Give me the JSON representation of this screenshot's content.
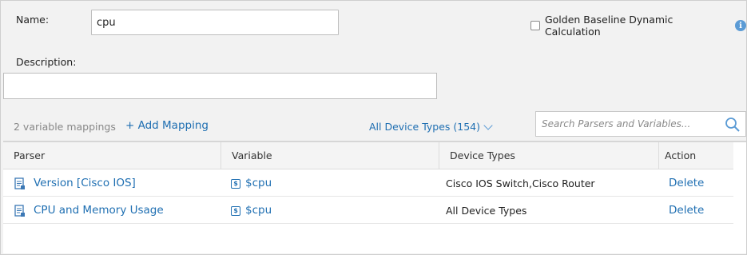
{
  "form": {
    "name_label": "Name:",
    "name_value": "cpu",
    "description_label": "Description:",
    "description_value": "",
    "golden_baseline_label": "Golden Baseline Dynamic Calculation",
    "golden_baseline_checked": false
  },
  "toolbar": {
    "mappings_count": "2 variable mappings",
    "add_mapping_label": "+ Add Mapping",
    "device_filter_label": "All Device Types (154)",
    "search_placeholder": "Search Parsers and Variables..."
  },
  "table": {
    "headers": {
      "parser": "Parser",
      "variable": "Variable",
      "device_types": "Device Types",
      "action": "Action"
    },
    "rows": [
      {
        "parser": "Version [Cisco IOS]",
        "variable": "$cpu",
        "device_types": "Cisco IOS Switch,Cisco Router",
        "action": "Delete"
      },
      {
        "parser": "CPU and Memory Usage",
        "variable": "$cpu",
        "device_types": "All Device Types",
        "action": "Delete"
      }
    ]
  },
  "colors": {
    "link": "#1f6fb2",
    "info_icon": "#5b9bd5",
    "panel_bg": "#f2f2f2"
  },
  "icons": {
    "info": "info-icon",
    "search": "search-icon",
    "parser": "document-icon",
    "variable": "variable-icon",
    "dropdown": "chevron-down-icon"
  }
}
